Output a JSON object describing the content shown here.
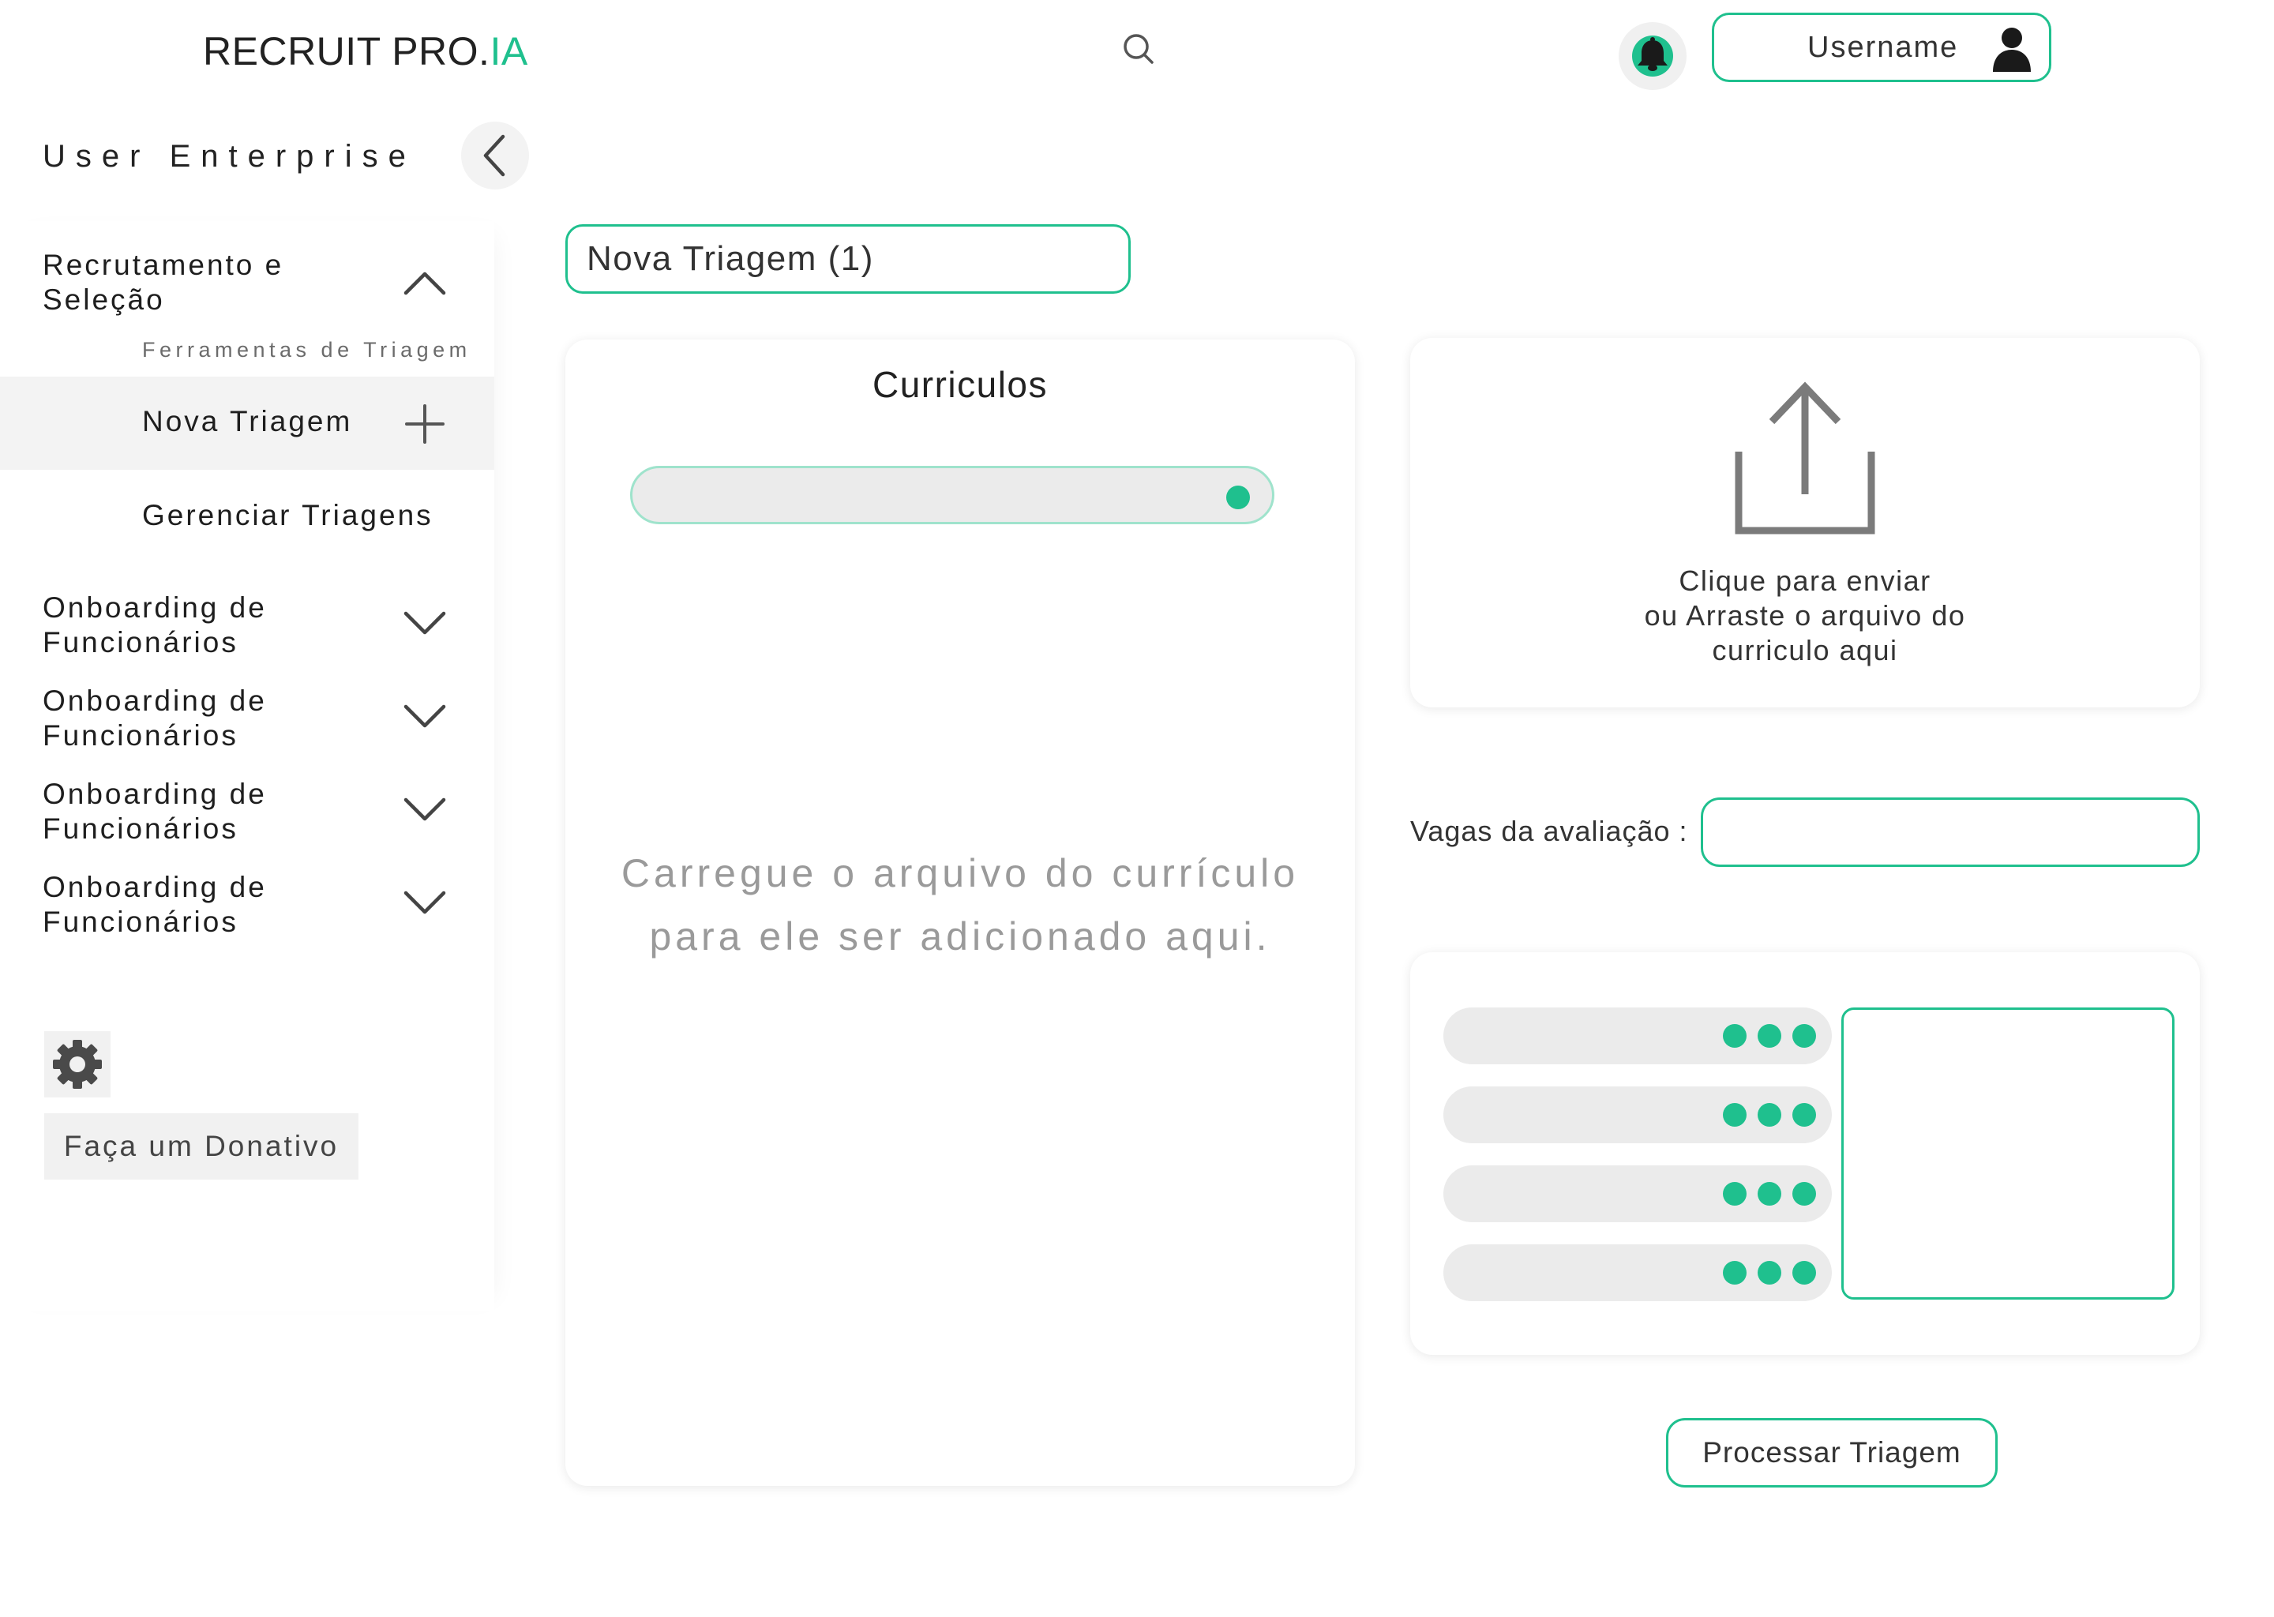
{
  "header": {
    "brand_main": "RECRUIT PRO.",
    "brand_accent": "IA",
    "username": "Username",
    "icons": {
      "search": "search-icon",
      "notifications": "bell-icon",
      "user": "user-icon"
    }
  },
  "sidebar": {
    "account": "User Enterprise",
    "collapse_icon": "chevron-left-icon",
    "sections": [
      {
        "title_line1": "Recrutamento e",
        "title_line2": "Seleção",
        "expanded": true,
        "caption": "Ferramentas de Triagem",
        "items": [
          {
            "label": "Nova Triagem",
            "active": true,
            "icon": "plus-icon"
          },
          {
            "label": "Gerenciar Triagens",
            "active": false
          }
        ]
      },
      {
        "title_line1": "Onboarding de",
        "title_line2": "Funcionários",
        "expanded": false
      },
      {
        "title_line1": "Onboarding de",
        "title_line2": "Funcionários",
        "expanded": false
      },
      {
        "title_line1": "Onboarding de",
        "title_line2": "Funcionários",
        "expanded": false
      },
      {
        "title_line1": "Onboarding de",
        "title_line2": "Funcionários",
        "expanded": false
      }
    ],
    "settings_icon": "gear-icon",
    "donate_label": "Faça um Donativo"
  },
  "main": {
    "tab_label": "Nova Triagem (1)",
    "curriculos": {
      "title": "Curriculos",
      "empty_line1": "Carregue o arquivo do currículo",
      "empty_line2": "para ele ser adicionado aqui."
    },
    "upload": {
      "icon": "upload-icon",
      "line1": "Clique para enviar",
      "line2": "ou Arraste o arquivo do",
      "line3": "curriculo aqui"
    },
    "vagas": {
      "label": "Vagas da avaliação :",
      "value": ""
    },
    "process_label": "Processar Triagem"
  },
  "colors": {
    "accent": "#1fc08e",
    "panel_gray": "#ebebeb",
    "sidebar_active": "#f3f3f3"
  }
}
